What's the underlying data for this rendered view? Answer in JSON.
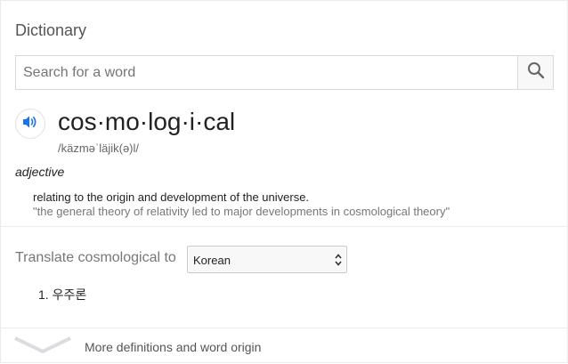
{
  "dictionary": {
    "title": "Dictionary",
    "search": {
      "placeholder": "Search for a word",
      "value": ""
    },
    "entry": {
      "headword": "cos·mo·log·i·cal",
      "pronunciation": "/käzməˈläjik(ə)l/",
      "part_of_speech": "adjective",
      "definition": "relating to the origin and development of the universe.",
      "example": "\"the general theory of relativity led to major developments in cosmological theory\""
    },
    "translate": {
      "label": "Translate cosmological to",
      "selected_language": "Korean",
      "results": [
        "1. 우주론"
      ]
    },
    "more_link": "More definitions and word origin"
  },
  "icons": {
    "search": "search-icon",
    "speaker": "speaker-icon",
    "select_arrows": "updown-arrows-icon",
    "expand": "chevron-down-icon"
  },
  "colors": {
    "speaker_blue": "#1a73e8",
    "chevron_gray": "#dadce0",
    "border": "#d9d9d9"
  }
}
